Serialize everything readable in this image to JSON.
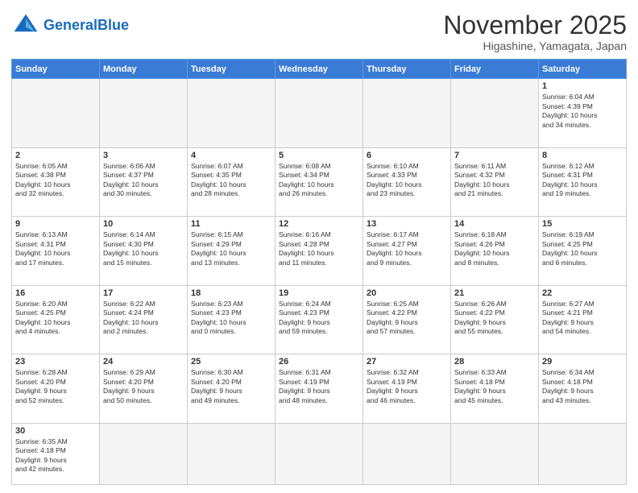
{
  "header": {
    "logo_general": "General",
    "logo_blue": "Blue",
    "month_title": "November 2025",
    "location": "Higashine, Yamagata, Japan"
  },
  "days_of_week": [
    "Sunday",
    "Monday",
    "Tuesday",
    "Wednesday",
    "Thursday",
    "Friday",
    "Saturday"
  ],
  "weeks": [
    [
      {
        "day": "",
        "info": ""
      },
      {
        "day": "",
        "info": ""
      },
      {
        "day": "",
        "info": ""
      },
      {
        "day": "",
        "info": ""
      },
      {
        "day": "",
        "info": ""
      },
      {
        "day": "",
        "info": ""
      },
      {
        "day": "1",
        "info": "Sunrise: 6:04 AM\nSunset: 4:39 PM\nDaylight: 10 hours\nand 34 minutes."
      }
    ],
    [
      {
        "day": "2",
        "info": "Sunrise: 6:05 AM\nSunset: 4:38 PM\nDaylight: 10 hours\nand 32 minutes."
      },
      {
        "day": "3",
        "info": "Sunrise: 6:06 AM\nSunset: 4:37 PM\nDaylight: 10 hours\nand 30 minutes."
      },
      {
        "day": "4",
        "info": "Sunrise: 6:07 AM\nSunset: 4:35 PM\nDaylight: 10 hours\nand 28 minutes."
      },
      {
        "day": "5",
        "info": "Sunrise: 6:08 AM\nSunset: 4:34 PM\nDaylight: 10 hours\nand 26 minutes."
      },
      {
        "day": "6",
        "info": "Sunrise: 6:10 AM\nSunset: 4:33 PM\nDaylight: 10 hours\nand 23 minutes."
      },
      {
        "day": "7",
        "info": "Sunrise: 6:11 AM\nSunset: 4:32 PM\nDaylight: 10 hours\nand 21 minutes."
      },
      {
        "day": "8",
        "info": "Sunrise: 6:12 AM\nSunset: 4:31 PM\nDaylight: 10 hours\nand 19 minutes."
      }
    ],
    [
      {
        "day": "9",
        "info": "Sunrise: 6:13 AM\nSunset: 4:31 PM\nDaylight: 10 hours\nand 17 minutes."
      },
      {
        "day": "10",
        "info": "Sunrise: 6:14 AM\nSunset: 4:30 PM\nDaylight: 10 hours\nand 15 minutes."
      },
      {
        "day": "11",
        "info": "Sunrise: 6:15 AM\nSunset: 4:29 PM\nDaylight: 10 hours\nand 13 minutes."
      },
      {
        "day": "12",
        "info": "Sunrise: 6:16 AM\nSunset: 4:28 PM\nDaylight: 10 hours\nand 11 minutes."
      },
      {
        "day": "13",
        "info": "Sunrise: 6:17 AM\nSunset: 4:27 PM\nDaylight: 10 hours\nand 9 minutes."
      },
      {
        "day": "14",
        "info": "Sunrise: 6:18 AM\nSunset: 4:26 PM\nDaylight: 10 hours\nand 8 minutes."
      },
      {
        "day": "15",
        "info": "Sunrise: 6:19 AM\nSunset: 4:25 PM\nDaylight: 10 hours\nand 6 minutes."
      }
    ],
    [
      {
        "day": "16",
        "info": "Sunrise: 6:20 AM\nSunset: 4:25 PM\nDaylight: 10 hours\nand 4 minutes."
      },
      {
        "day": "17",
        "info": "Sunrise: 6:22 AM\nSunset: 4:24 PM\nDaylight: 10 hours\nand 2 minutes."
      },
      {
        "day": "18",
        "info": "Sunrise: 6:23 AM\nSunset: 4:23 PM\nDaylight: 10 hours\nand 0 minutes."
      },
      {
        "day": "19",
        "info": "Sunrise: 6:24 AM\nSunset: 4:23 PM\nDaylight: 9 hours\nand 59 minutes."
      },
      {
        "day": "20",
        "info": "Sunrise: 6:25 AM\nSunset: 4:22 PM\nDaylight: 9 hours\nand 57 minutes."
      },
      {
        "day": "21",
        "info": "Sunrise: 6:26 AM\nSunset: 4:22 PM\nDaylight: 9 hours\nand 55 minutes."
      },
      {
        "day": "22",
        "info": "Sunrise: 6:27 AM\nSunset: 4:21 PM\nDaylight: 9 hours\nand 54 minutes."
      }
    ],
    [
      {
        "day": "23",
        "info": "Sunrise: 6:28 AM\nSunset: 4:20 PM\nDaylight: 9 hours\nand 52 minutes."
      },
      {
        "day": "24",
        "info": "Sunrise: 6:29 AM\nSunset: 4:20 PM\nDaylight: 9 hours\nand 50 minutes."
      },
      {
        "day": "25",
        "info": "Sunrise: 6:30 AM\nSunset: 4:20 PM\nDaylight: 9 hours\nand 49 minutes."
      },
      {
        "day": "26",
        "info": "Sunrise: 6:31 AM\nSunset: 4:19 PM\nDaylight: 9 hours\nand 48 minutes."
      },
      {
        "day": "27",
        "info": "Sunrise: 6:32 AM\nSunset: 4:19 PM\nDaylight: 9 hours\nand 46 minutes."
      },
      {
        "day": "28",
        "info": "Sunrise: 6:33 AM\nSunset: 4:18 PM\nDaylight: 9 hours\nand 45 minutes."
      },
      {
        "day": "29",
        "info": "Sunrise: 6:34 AM\nSunset: 4:18 PM\nDaylight: 9 hours\nand 43 minutes."
      }
    ],
    [
      {
        "day": "30",
        "info": "Sunrise: 6:35 AM\nSunset: 4:18 PM\nDaylight: 9 hours\nand 42 minutes."
      },
      {
        "day": "",
        "info": ""
      },
      {
        "day": "",
        "info": ""
      },
      {
        "day": "",
        "info": ""
      },
      {
        "day": "",
        "info": ""
      },
      {
        "day": "",
        "info": ""
      },
      {
        "day": "",
        "info": ""
      }
    ]
  ]
}
